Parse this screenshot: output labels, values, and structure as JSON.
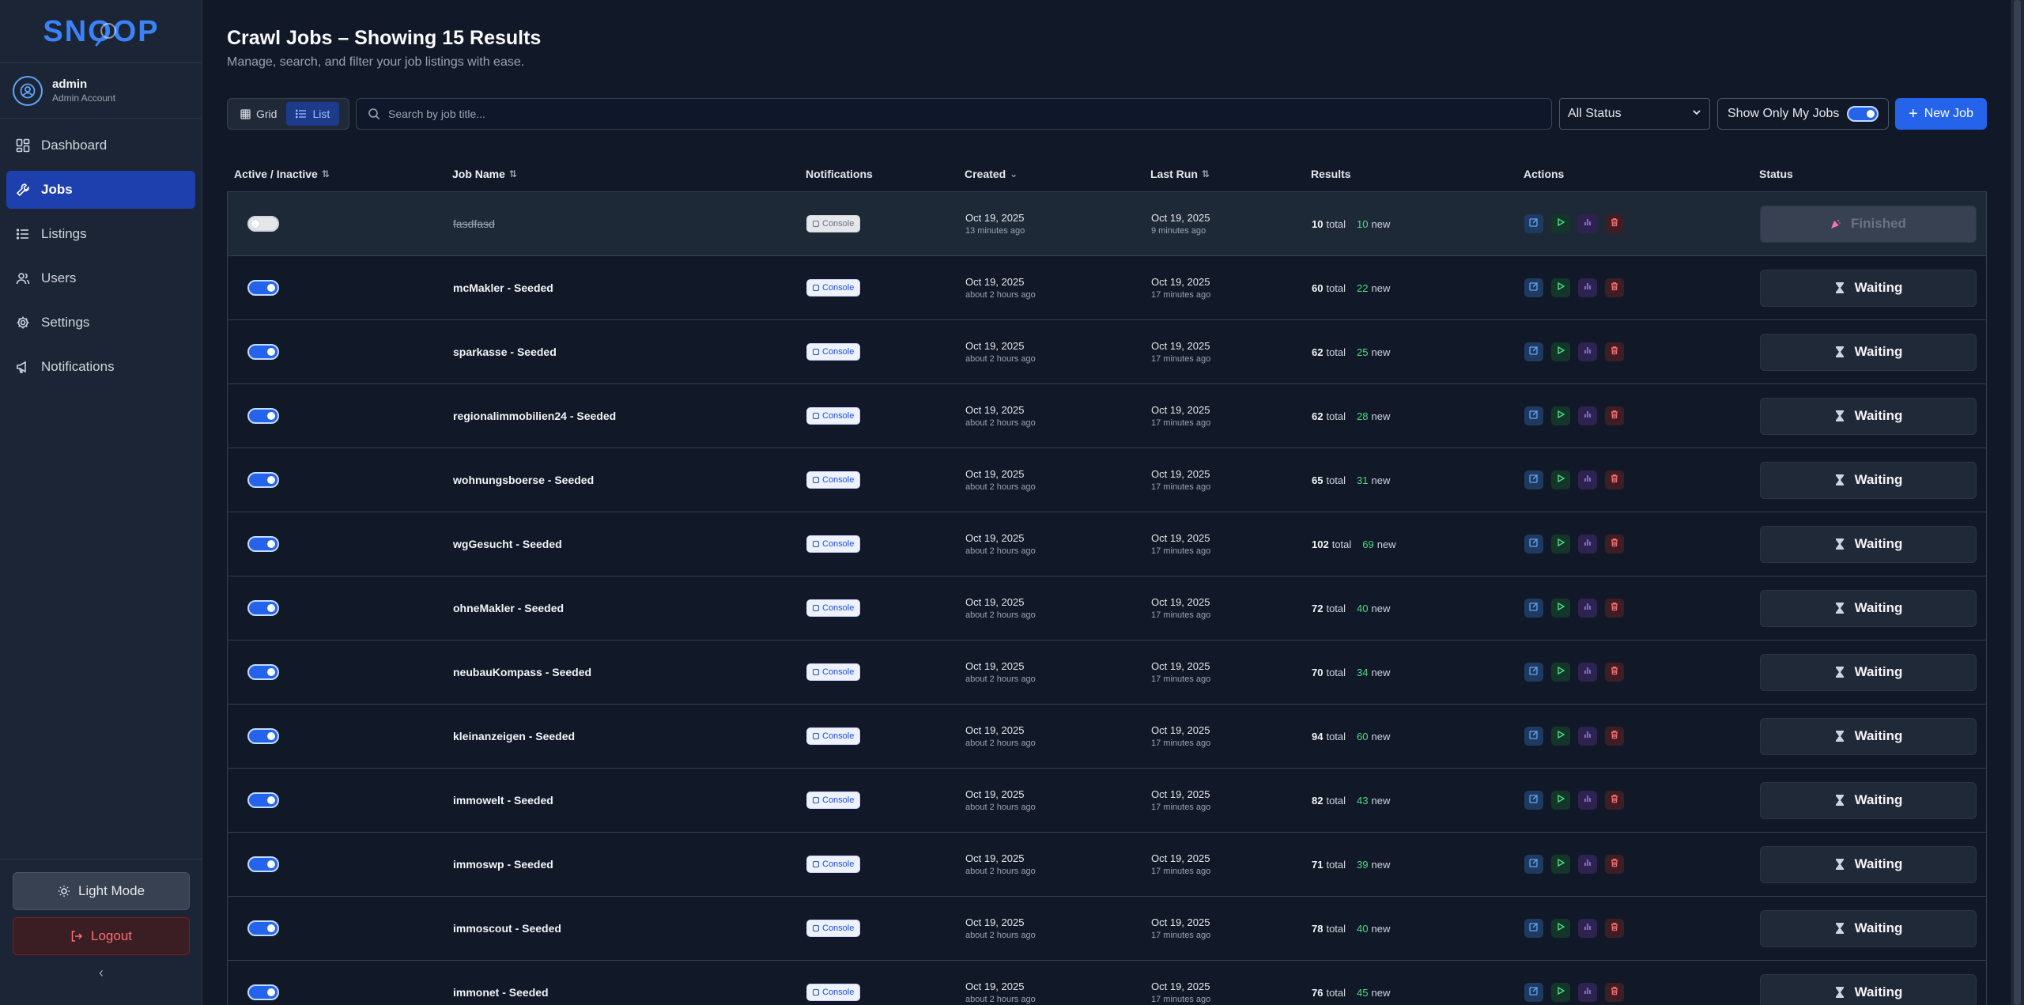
{
  "app": {
    "logo_text": "SNOOP"
  },
  "colors": {
    "accent": "#2563eb",
    "bg": "#111827",
    "sidebar": "#1b2535",
    "new": "#4ade80",
    "danger": "#f87171"
  },
  "user": {
    "name": "admin",
    "role": "Admin Account"
  },
  "nav": [
    {
      "label": "Dashboard",
      "icon": "dashboard-icon"
    },
    {
      "label": "Jobs",
      "icon": "wrench-icon",
      "active": true
    },
    {
      "label": "Listings",
      "icon": "list-icon"
    },
    {
      "label": "Users",
      "icon": "users-icon"
    },
    {
      "label": "Settings",
      "icon": "gear-icon"
    },
    {
      "label": "Notifications",
      "icon": "megaphone-icon"
    }
  ],
  "sidebar_bottom": {
    "theme_label": "Light Mode",
    "logout_label": "Logout",
    "collapse_label": "‹"
  },
  "header": {
    "title": "Crawl Jobs – Showing 15 Results",
    "subtitle": "Manage, search, and filter your job listings with ease."
  },
  "toolbar": {
    "view_grid": "Grid",
    "view_list": "List",
    "search_placeholder": "Search by job title...",
    "status_value": "All Status",
    "my_jobs_label": "Show Only My Jobs",
    "new_job_label": "New Job"
  },
  "table": {
    "headers": {
      "active": "Active / Inactive",
      "name": "Job Name",
      "notifications": "Notifications",
      "created": "Created",
      "last_run": "Last Run",
      "results": "Results",
      "actions": "Actions",
      "status": "Status"
    },
    "total_word": "total",
    "new_word": "new",
    "rows": [
      {
        "active": false,
        "name": "fasdfasd",
        "notification": "Console",
        "created": "Oct 19, 2025",
        "created_ago": "13 minutes ago",
        "last_run": "Oct 19, 2025",
        "last_run_ago": "9 minutes ago",
        "total": "10",
        "new": "10",
        "status": "Finished"
      },
      {
        "active": true,
        "name": "mcMakler - Seeded",
        "notification": "Console",
        "created": "Oct 19, 2025",
        "created_ago": "about 2 hours ago",
        "last_run": "Oct 19, 2025",
        "last_run_ago": "17 minutes ago",
        "total": "60",
        "new": "22",
        "status": "Waiting"
      },
      {
        "active": true,
        "name": "sparkasse - Seeded",
        "notification": "Console",
        "created": "Oct 19, 2025",
        "created_ago": "about 2 hours ago",
        "last_run": "Oct 19, 2025",
        "last_run_ago": "17 minutes ago",
        "total": "62",
        "new": "25",
        "status": "Waiting"
      },
      {
        "active": true,
        "name": "regionalimmobilien24 - Seeded",
        "notification": "Console",
        "created": "Oct 19, 2025",
        "created_ago": "about 2 hours ago",
        "last_run": "Oct 19, 2025",
        "last_run_ago": "17 minutes ago",
        "total": "62",
        "new": "28",
        "status": "Waiting"
      },
      {
        "active": true,
        "name": "wohnungsboerse - Seeded",
        "notification": "Console",
        "created": "Oct 19, 2025",
        "created_ago": "about 2 hours ago",
        "last_run": "Oct 19, 2025",
        "last_run_ago": "17 minutes ago",
        "total": "65",
        "new": "31",
        "status": "Waiting"
      },
      {
        "active": true,
        "name": "wgGesucht - Seeded",
        "notification": "Console",
        "created": "Oct 19, 2025",
        "created_ago": "about 2 hours ago",
        "last_run": "Oct 19, 2025",
        "last_run_ago": "17 minutes ago",
        "total": "102",
        "new": "69",
        "status": "Waiting"
      },
      {
        "active": true,
        "name": "ohneMakler - Seeded",
        "notification": "Console",
        "created": "Oct 19, 2025",
        "created_ago": "about 2 hours ago",
        "last_run": "Oct 19, 2025",
        "last_run_ago": "17 minutes ago",
        "total": "72",
        "new": "40",
        "status": "Waiting"
      },
      {
        "active": true,
        "name": "neubauKompass - Seeded",
        "notification": "Console",
        "created": "Oct 19, 2025",
        "created_ago": "about 2 hours ago",
        "last_run": "Oct 19, 2025",
        "last_run_ago": "17 minutes ago",
        "total": "70",
        "new": "34",
        "status": "Waiting"
      },
      {
        "active": true,
        "name": "kleinanzeigen - Seeded",
        "notification": "Console",
        "created": "Oct 19, 2025",
        "created_ago": "about 2 hours ago",
        "last_run": "Oct 19, 2025",
        "last_run_ago": "17 minutes ago",
        "total": "94",
        "new": "60",
        "status": "Waiting"
      },
      {
        "active": true,
        "name": "immowelt - Seeded",
        "notification": "Console",
        "created": "Oct 19, 2025",
        "created_ago": "about 2 hours ago",
        "last_run": "Oct 19, 2025",
        "last_run_ago": "17 minutes ago",
        "total": "82",
        "new": "43",
        "status": "Waiting"
      },
      {
        "active": true,
        "name": "immoswp - Seeded",
        "notification": "Console",
        "created": "Oct 19, 2025",
        "created_ago": "about 2 hours ago",
        "last_run": "Oct 19, 2025",
        "last_run_ago": "17 minutes ago",
        "total": "71",
        "new": "39",
        "status": "Waiting"
      },
      {
        "active": true,
        "name": "immoscout - Seeded",
        "notification": "Console",
        "created": "Oct 19, 2025",
        "created_ago": "about 2 hours ago",
        "last_run": "Oct 19, 2025",
        "last_run_ago": "17 minutes ago",
        "total": "78",
        "new": "40",
        "status": "Waiting"
      },
      {
        "active": true,
        "name": "immonet - Seeded",
        "notification": "Console",
        "created": "Oct 19, 2025",
        "created_ago": "about 2 hours ago",
        "last_run": "Oct 19, 2025",
        "last_run_ago": "17 minutes ago",
        "total": "76",
        "new": "45",
        "status": "Waiting"
      }
    ]
  }
}
